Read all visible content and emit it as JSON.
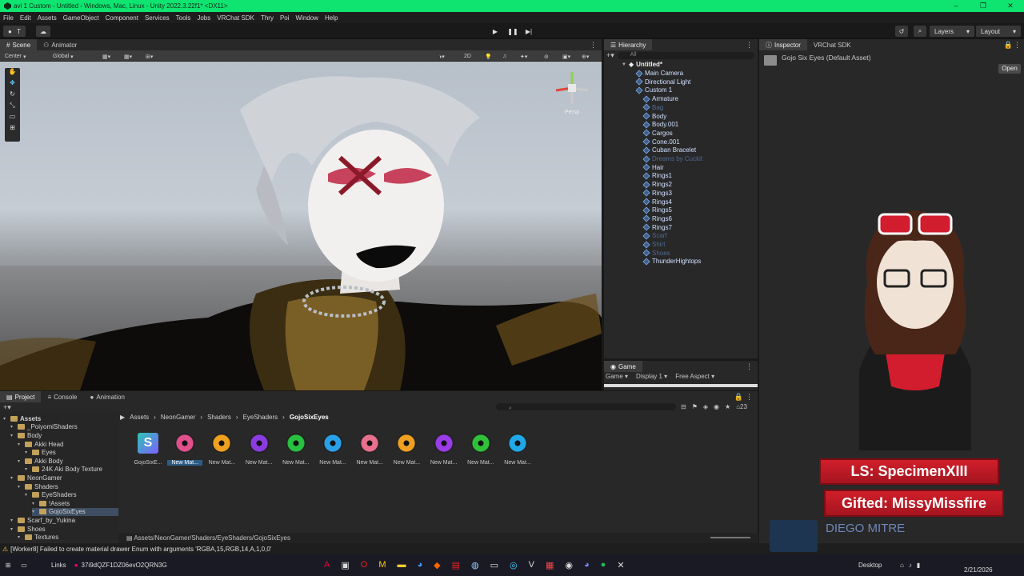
{
  "window": {
    "title": "avi 1 Custom - Untitled - Windows, Mac, Linux - Unity 2022.3.22f1* <DX11>",
    "controls": [
      "–",
      "❐",
      "✕"
    ]
  },
  "menu": [
    "File",
    "Edit",
    "Assets",
    "GameObject",
    "Component",
    "Services",
    "Tools",
    "Jobs",
    "VRChat SDK",
    "Thry",
    "Poi",
    "Window",
    "Help"
  ],
  "toolbar": {
    "account_label": "T",
    "layers_label": "Layers",
    "layout_label": "Layout"
  },
  "scene_tabs": [
    "Scene",
    "Animator"
  ],
  "scene_toolbar": {
    "pivot": "Center",
    "space": "Global",
    "mode_2d": "2D",
    "persp_label": "Persp"
  },
  "hierarchy": {
    "tab": "Hierarchy",
    "search_placeholder": "All",
    "scene_name": "Untitled*",
    "rows": [
      {
        "label": "Main Camera",
        "depth": 1,
        "dim": false
      },
      {
        "label": "Directional Light",
        "depth": 1,
        "dim": false
      },
      {
        "label": "Custom 1",
        "depth": 1,
        "dim": false
      },
      {
        "label": "Armature",
        "depth": 2,
        "dim": false
      },
      {
        "label": "Bag",
        "depth": 2,
        "dim": true
      },
      {
        "label": "Body",
        "depth": 2,
        "dim": false
      },
      {
        "label": "Body.001",
        "depth": 2,
        "dim": false
      },
      {
        "label": "Cargos",
        "depth": 2,
        "dim": false
      },
      {
        "label": "Cone.001",
        "depth": 2,
        "dim": false
      },
      {
        "label": "Cuban Bracelet",
        "depth": 2,
        "dim": false
      },
      {
        "label": "Dreams by Cuckit",
        "depth": 2,
        "dim": true
      },
      {
        "label": "Hair",
        "depth": 2,
        "dim": false
      },
      {
        "label": "Rings1",
        "depth": 2,
        "dim": false
      },
      {
        "label": "Rings2",
        "depth": 2,
        "dim": false
      },
      {
        "label": "Rings3",
        "depth": 2,
        "dim": false
      },
      {
        "label": "Rings4",
        "depth": 2,
        "dim": false
      },
      {
        "label": "Rings5",
        "depth": 2,
        "dim": false
      },
      {
        "label": "Rings6",
        "depth": 2,
        "dim": false
      },
      {
        "label": "Rings7",
        "depth": 2,
        "dim": false
      },
      {
        "label": "Scarf",
        "depth": 2,
        "dim": true
      },
      {
        "label": "Shirt",
        "depth": 2,
        "dim": true
      },
      {
        "label": "Shoes",
        "depth": 2,
        "dim": true
      },
      {
        "label": "ThunderHightops",
        "depth": 2,
        "dim": false
      }
    ]
  },
  "game": {
    "tab": "Game",
    "mode": "Game",
    "display": "Display 1",
    "aspect": "Free Aspect"
  },
  "inspector": {
    "tabs": [
      "Inspector",
      "VRChat SDK"
    ],
    "asset_title": "Gojo Six Eyes (Default Asset)",
    "open_button": "Open"
  },
  "project": {
    "tabs": [
      "Project",
      "Console",
      "Animation"
    ],
    "breadcrumb": [
      "Assets",
      "NeonGamer",
      "Shaders",
      "EyeShaders",
      "GojoSixEyes"
    ],
    "count": "23",
    "path": "Assets/NeonGamer/Shaders/EyeShaders/GojoSixEyes",
    "tree": [
      {
        "label": "Assets",
        "depth": 0,
        "bold": true
      },
      {
        "label": "_PoiyomiShaders",
        "depth": 1
      },
      {
        "label": "Body",
        "depth": 1
      },
      {
        "label": "Akki Head",
        "depth": 2
      },
      {
        "label": "Eyes",
        "depth": 3
      },
      {
        "label": "Akki Body",
        "depth": 2
      },
      {
        "label": "24K Aki Body Texture",
        "depth": 3
      },
      {
        "label": "NeonGamer",
        "depth": 1
      },
      {
        "label": "Shaders",
        "depth": 2
      },
      {
        "label": "EyeShaders",
        "depth": 3
      },
      {
        "label": "!Assets",
        "depth": 4
      },
      {
        "label": "GojoSixEyes",
        "depth": 4,
        "selected": true
      },
      {
        "label": "Scarf_by_Yukina",
        "depth": 1
      },
      {
        "label": "Shoes",
        "depth": 1
      },
      {
        "label": "Textures",
        "depth": 2
      }
    ],
    "assets": [
      {
        "label": "GojoSixE...",
        "kind": "shader"
      },
      {
        "label": "New Mat...",
        "color": "#e0508a",
        "selected": true
      },
      {
        "label": "New Mat...",
        "color": "#f0a020"
      },
      {
        "label": "New Mat...",
        "color": "#8a3ce0"
      },
      {
        "label": "New Mat...",
        "color": "#28c040"
      },
      {
        "label": "New Mat...",
        "color": "#2aa0e8"
      },
      {
        "label": "New Mat...",
        "color": "#e8708c"
      },
      {
        "label": "New Mat...",
        "color": "#f0a020"
      },
      {
        "label": "New Mat...",
        "color": "#9a3ce8"
      },
      {
        "label": "New Mat...",
        "color": "#30c03a"
      },
      {
        "label": "New Mat...",
        "color": "#20a8e8"
      }
    ]
  },
  "status": {
    "message": "[Worker8] Failed to create material drawer Enum with arguments 'RGBA,15,RGB,14,A,1,0,0'"
  },
  "taskbar": {
    "links_label": "Links",
    "search_text": "37i9dQZF1DZ06evO2QRN3G",
    "desktop_label": "Desktop",
    "date": "2/21/2026"
  },
  "overlay": {
    "ls": "LS: SpecimenXIII",
    "gifted": "Gifted: MissyMissfire",
    "name": "DIEGO MITRE"
  }
}
